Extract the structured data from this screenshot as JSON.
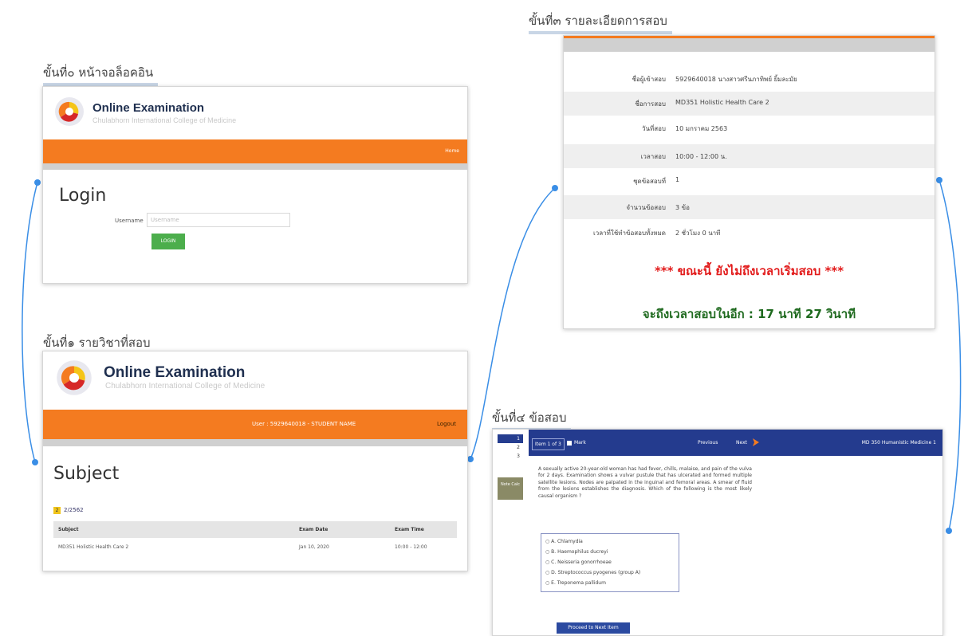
{
  "captions": {
    "step0": "ขั้นที่๐ หน้าจอล็อคอิน",
    "step1": "ขั้นที่๑ รายวิชาที่สอบ",
    "step2": "ขั้นที่๓ รายละเอียดการสอบ",
    "step3": "ขั้นที่๔ ข้อสอบ"
  },
  "brand": {
    "title": "Online Examination",
    "subtitle": "Chulabhorn International College of Medicine"
  },
  "login_screen": {
    "menu_text": "Home",
    "heading": "Login",
    "username_label": "Username",
    "username_placeholder": "Username",
    "login_button": "LOGIN"
  },
  "subject_screen": {
    "user_info": "User : 5929640018 - STUDENT NAME",
    "logout": "Logout",
    "heading": "Subject",
    "year_badge": "2",
    "year": "2/2562",
    "table": {
      "headers": [
        "Subject",
        "Exam Date",
        "Exam Time"
      ],
      "rows": [
        [
          "MD351 Holistic Health Care 2",
          "Jan 10, 2020",
          "10:00 - 12:00"
        ]
      ]
    }
  },
  "detail_screen": {
    "rows": [
      {
        "label": "ชื่อผู้เข้าสอบ",
        "value": "5929640018 นางสาวศรีนภาทิพย์ ยิ้มละมัย"
      },
      {
        "label": "ชื่อการสอบ",
        "value": "MD351 Holistic Health Care 2"
      },
      {
        "label": "วันที่สอบ",
        "value": "10 มกราคม 2563"
      },
      {
        "label": "เวลาสอบ",
        "value": "10:00 - 12:00 น."
      },
      {
        "label": "ชุดข้อสอบที่",
        "value": "1"
      },
      {
        "label": "จำนวนข้อสอบ",
        "value": "3 ข้อ"
      },
      {
        "label": "เวลาที่ใช้ทำข้อสอบทั้งหมด",
        "value": "2 ชั่วโมง 0 นาที"
      }
    ],
    "warning": "*** ขณะนี้ ยังไม่ถึงเวลาเริ่มสอบ ***",
    "countdown": "จะถึงเวลาสอบในอีก : 17 นาที 27 วินาที"
  },
  "exam_screen": {
    "question_nav": [
      "1",
      "2",
      "3"
    ],
    "notes_label": "Note Calc",
    "item_label": "Item 1 of 3",
    "mark_label": "Mark",
    "previous": "Previous",
    "next": "Next",
    "course": "MD 350 Humanistic Medicine 1",
    "question": "A sexually active 20-year-old woman has had fever, chills, malaise, and pain of the vulva for 2 days. Examination shows a vulvar pustule that has ulcerated and formed multiple satellite lesions. Nodes are palpated in the inguinal and femoral areas. A smear of fluid from the lesions establishes the diagnosis. Which of the following is the most likely causal organism ?",
    "options": [
      "A. Chlamydia",
      "B. Haemophilus ducreyi",
      "C. Neisseria gonorrhoeae",
      "D. Streptococcus pyogenes (group A)",
      "E. Treponema pallidum"
    ],
    "proceed_button": "Proceed to Next Item"
  },
  "colors": {
    "accent_orange": "#f47b20",
    "exam_blue": "#243b8e",
    "warning_red": "#e21b1b",
    "countdown_green": "#1f6a1f",
    "connector_blue": "#3a8ee6"
  }
}
